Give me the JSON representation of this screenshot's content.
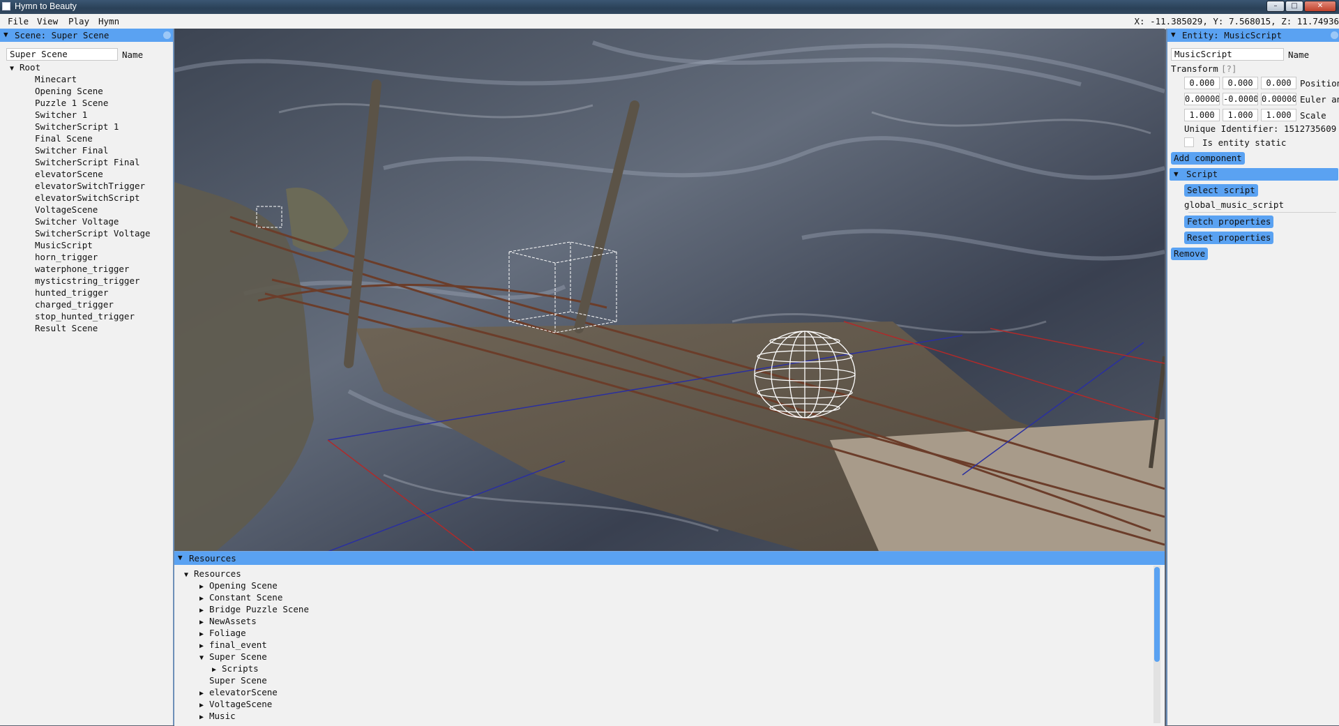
{
  "window": {
    "title": "Hymn to Beauty",
    "minimize_label": "–",
    "maximize_label": "□",
    "close_label": "✕"
  },
  "menu": {
    "items": [
      "File",
      "View",
      "Play",
      "Hymn"
    ],
    "coordinates": "X: -11.385029, Y: 7.568015, Z: 11.74936"
  },
  "scene_panel": {
    "header": "Scene: Super Scene",
    "name_value": "Super Scene",
    "name_label": "Name",
    "root_label": "Root",
    "entities": [
      "Minecart",
      "Opening Scene",
      "Puzzle 1 Scene",
      "Switcher 1",
      "SwitcherScript 1",
      "Final Scene",
      "Switcher Final",
      "SwitcherScript Final",
      "elevatorScene",
      "elevatorSwitchTrigger",
      "elevatorSwitchScript",
      "VoltageScene",
      "Switcher Voltage",
      "SwitcherScript Voltage",
      "MusicScript",
      "horn_trigger",
      "waterphone_trigger",
      "mysticstring_trigger",
      "hunted_trigger",
      "charged_trigger",
      "stop_hunted_trigger",
      "Result Scene"
    ]
  },
  "entity_panel": {
    "header": "Entity: MusicScript",
    "name_value": "MusicScript",
    "name_label": "Name",
    "transform_label": "Transform",
    "transform_help": "[?]",
    "position": [
      "0.000",
      "0.000",
      "0.000"
    ],
    "position_label": "Position",
    "euler": [
      "0.00000",
      "-0.0000",
      "0.00000"
    ],
    "euler_label": "Euler angles",
    "scale": [
      "1.000",
      "1.000",
      "1.000"
    ],
    "scale_label": "Scale",
    "unique_identifier": "Unique Identifier: 1512735609",
    "static_label": "Is entity static",
    "add_component_label": "Add component",
    "script_header": "Script",
    "select_script_label": "Select script",
    "script_name": "global_music_script",
    "fetch_properties_label": "Fetch properties",
    "reset_properties_label": "Reset properties",
    "remove_label": "Remove"
  },
  "resources_panel": {
    "header": "Resources",
    "root_label": "Resources",
    "items": [
      {
        "label": "Opening Scene",
        "icon": "collapsed",
        "depth": 1
      },
      {
        "label": "Constant Scene",
        "icon": "collapsed",
        "depth": 1
      },
      {
        "label": "Bridge Puzzle Scene",
        "icon": "collapsed",
        "depth": 1
      },
      {
        "label": "NewAssets",
        "icon": "collapsed",
        "depth": 1
      },
      {
        "label": "Foliage",
        "icon": "collapsed",
        "depth": 1
      },
      {
        "label": "final_event",
        "icon": "collapsed",
        "depth": 1
      },
      {
        "label": "Super Scene",
        "icon": "expanded",
        "depth": 1
      },
      {
        "label": "Scripts",
        "icon": "collapsed",
        "depth": 2
      },
      {
        "label": "Super Scene",
        "icon": "none",
        "depth": 1
      },
      {
        "label": "elevatorScene",
        "icon": "collapsed",
        "depth": 1
      },
      {
        "label": "VoltageScene",
        "icon": "collapsed",
        "depth": 1
      },
      {
        "label": "Music",
        "icon": "collapsed",
        "depth": 1
      }
    ]
  },
  "icons": {
    "expanded": "▼",
    "collapsed": "▶"
  },
  "colors": {
    "accent": "#5aa2f2",
    "panel_bg": "#f1f1f1",
    "title_bar": "#2a4158"
  }
}
